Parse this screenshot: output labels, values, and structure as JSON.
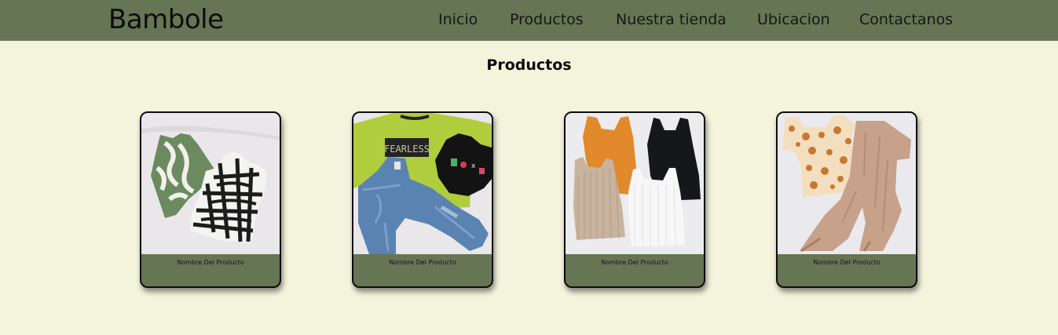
{
  "header": {
    "brand": "Bambole",
    "nav": [
      {
        "label": "Inicio"
      },
      {
        "label": "Productos"
      },
      {
        "label": "Nuestra tienda"
      },
      {
        "label": "Ubicacion"
      },
      {
        "label": "Contactanos"
      }
    ]
  },
  "main": {
    "title": "Productos",
    "products": [
      {
        "name": "Nombre Del Producto"
      },
      {
        "name": "Nombre Del Producto",
        "print_text": "FEARLESS"
      },
      {
        "name": "Nombre Del Producto"
      },
      {
        "name": "Nombre Del Producto"
      }
    ]
  },
  "colors": {
    "navbar": "#667554",
    "page_background": "#f4f3dc",
    "card_footer": "#667554",
    "card_border": "#0c0c0c"
  }
}
